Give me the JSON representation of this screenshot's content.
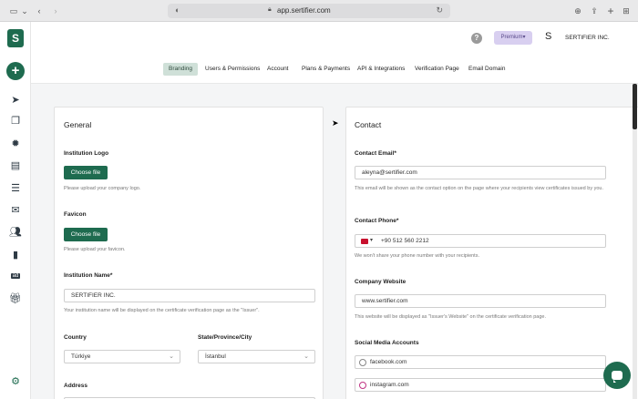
{
  "browser": {
    "url": "app.sertifier.com",
    "icons": [
      "sidebar-icon",
      "back-icon",
      "forward-icon",
      "shield-icon",
      "lock-icon",
      "reload-icon",
      "download-icon",
      "share-icon",
      "new-tab-icon",
      "tabs-icon"
    ]
  },
  "app": {
    "logo_text": "S",
    "add_symbol": "+",
    "header": {
      "help_symbol": "?",
      "premium_label": "Premium",
      "avatar_letter": "S",
      "company_name": "SERTIFIER INC."
    },
    "sidebar_icons": [
      "send-icon",
      "copy-icon",
      "badge-icon",
      "certificate-icon",
      "list-icon",
      "mail-icon",
      "users-icon",
      "chart-icon",
      "ad-icon",
      "gift-icon",
      "settings-icon"
    ],
    "sidebar_ad_text": "ad",
    "tabs": [
      {
        "label": "Branding",
        "active": true
      },
      {
        "label": "Users & Permissions",
        "active": false
      },
      {
        "label": "Account",
        "active": false
      },
      {
        "label": "Plans & Payments",
        "active": false
      },
      {
        "label": "API & Integrations",
        "active": false
      },
      {
        "label": "Verification Page",
        "active": false
      },
      {
        "label": "Email Domain",
        "active": false
      }
    ]
  },
  "general": {
    "title": "General",
    "logo_label": "Institution Logo",
    "logo_button": "Choose file",
    "logo_help": "Please upload your company logo.",
    "favicon_label": "Favicon",
    "favicon_button": "Choose file",
    "favicon_help": "Please upload your favicon.",
    "name_label": "Institution Name*",
    "name_value": "SERTIFIER INC.",
    "name_help": "Your institution name will be displayed on the certificate verification page as the \"Issuer\".",
    "country_label": "Country",
    "country_value": "Türkiye",
    "state_label": "State/Province/City",
    "state_value": "İstanbul",
    "address_label": "Address"
  },
  "contact": {
    "title": "Contact",
    "email_label": "Contact Email*",
    "email_value": "aleyna@sertifier.com",
    "email_help": "This email will be shown as the contact option on the page where your recipients view certificates issued by you.",
    "phone_label": "Contact Phone*",
    "phone_value": "+90 512 560 2212",
    "phone_help": "We won't share your phone number with your recipients.",
    "website_label": "Company Website",
    "website_value": "www.sertifier.com",
    "website_help": "This website will be displayed as \"Issuer's Website\" on the certificate verification page.",
    "social_label": "Social Media Accounts",
    "social_accounts": [
      "facebook.com",
      "instagram.com"
    ]
  }
}
